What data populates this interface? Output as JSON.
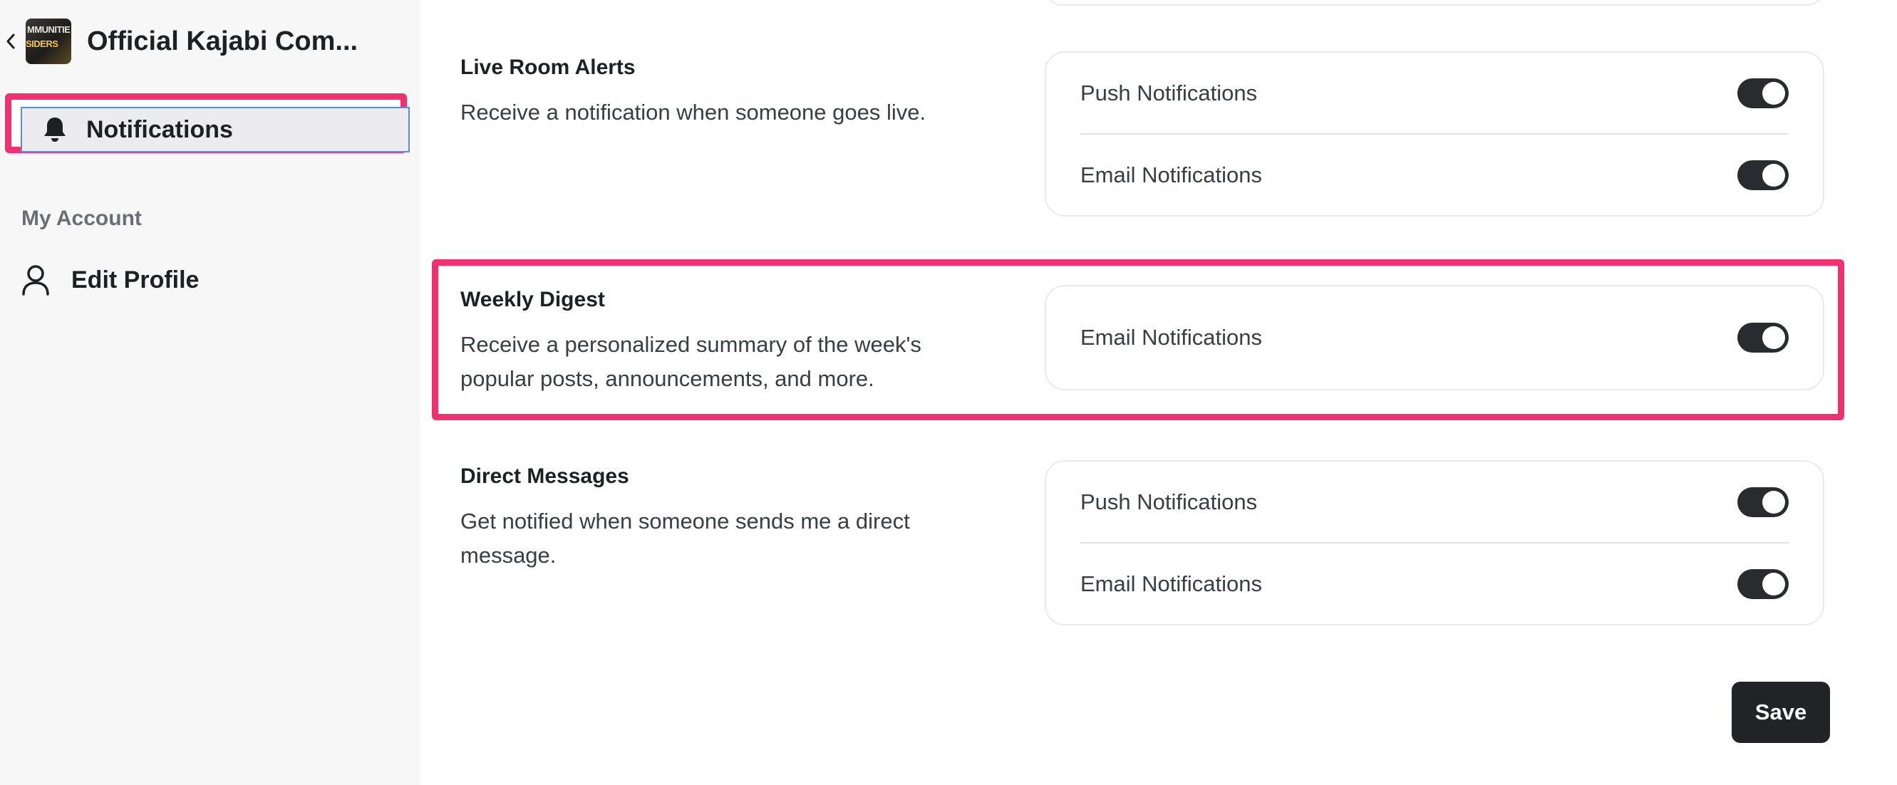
{
  "sidebar": {
    "community_name": "Official Kajabi Com...",
    "logo_text_line1": "MMUNITIE",
    "logo_text_line2": "SIDERS",
    "active_item": {
      "label": "Notifications",
      "icon": "bell-icon"
    },
    "section_label": "My Account",
    "items": [
      {
        "label": "Edit Profile",
        "icon": "user-icon"
      }
    ]
  },
  "sections": [
    {
      "title": "Live Room Alerts",
      "description": "Receive a notification when someone goes live.",
      "rows": [
        {
          "label": "Push Notifications",
          "enabled": true
        },
        {
          "label": "Email Notifications",
          "enabled": true
        }
      ]
    },
    {
      "title": "Weekly Digest",
      "description_line1": "Receive a personalized summary of the week's",
      "description_line2": "popular posts, announcements, and more.",
      "rows": [
        {
          "label": "Email Notifications",
          "enabled": true
        }
      ]
    },
    {
      "title": "Direct Messages",
      "description_line1": "Get notified when someone sends me a direct",
      "description_line2": "message.",
      "rows": [
        {
          "label": "Push Notifications",
          "enabled": true
        },
        {
          "label": "Email Notifications",
          "enabled": true
        }
      ]
    }
  ],
  "actions": {
    "save_label": "Save"
  },
  "colors": {
    "highlight": "#f2306f",
    "toggle_on": "#2a2b2e",
    "save_button": "#222327",
    "sidebar_bg": "#f7f7f8"
  }
}
